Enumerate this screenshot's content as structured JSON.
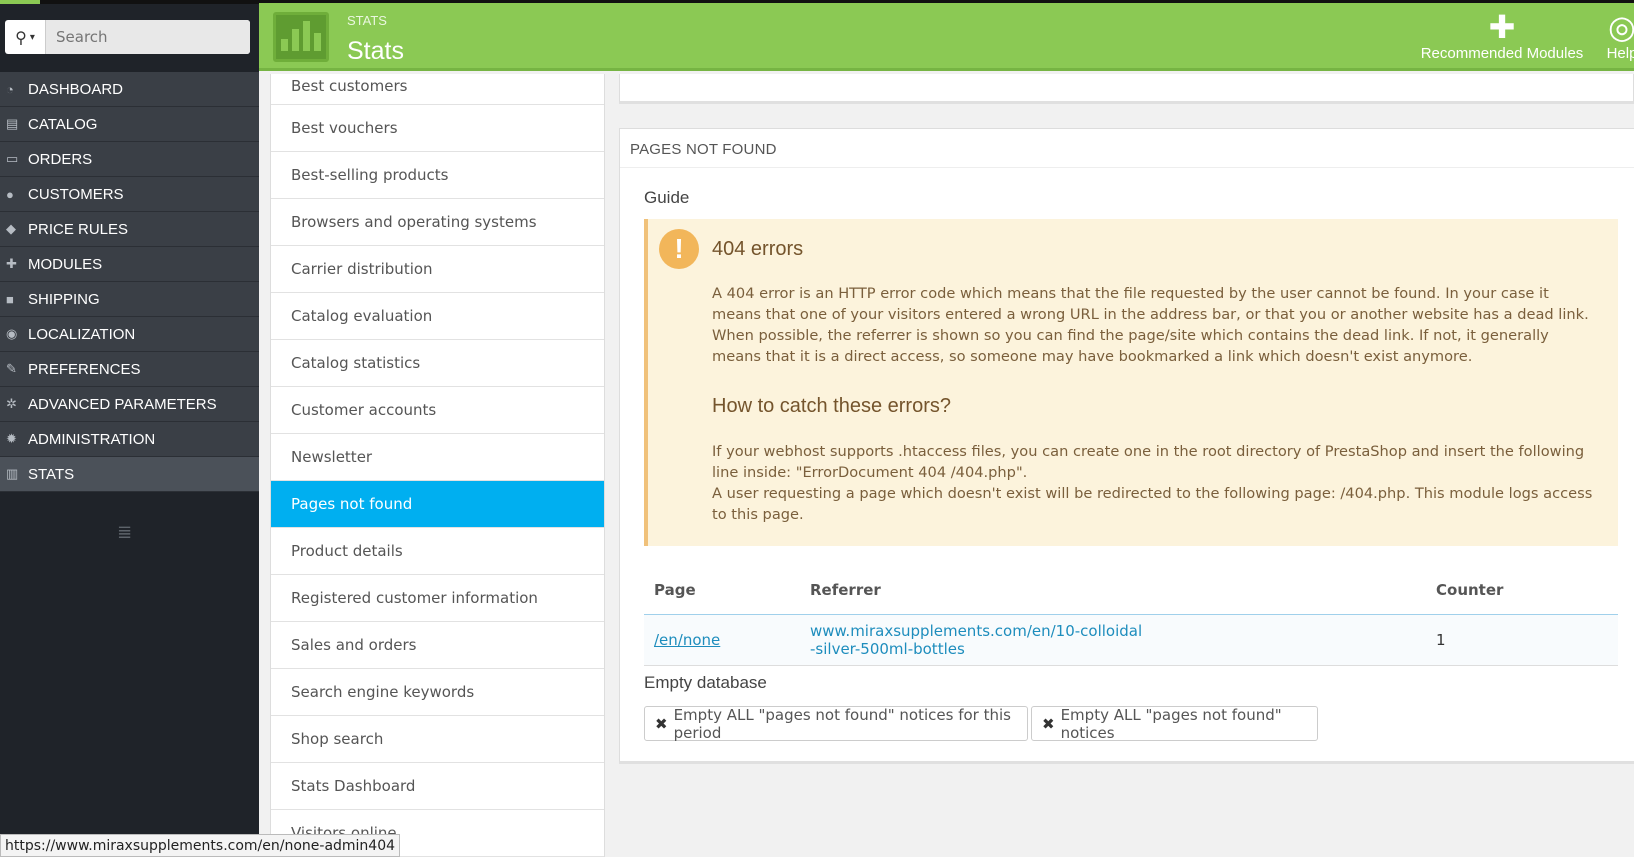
{
  "search": {
    "placeholder": "Search"
  },
  "sidebar": {
    "items": [
      {
        "label": "DASHBOARD",
        "icon": "tachometer-icon",
        "glyph": "◔"
      },
      {
        "label": "CATALOG",
        "icon": "book-icon",
        "glyph": "▤"
      },
      {
        "label": "ORDERS",
        "icon": "credit-card-icon",
        "glyph": "▭"
      },
      {
        "label": "CUSTOMERS",
        "icon": "users-icon",
        "glyph": "●"
      },
      {
        "label": "PRICE RULES",
        "icon": "tags-icon",
        "glyph": "◆"
      },
      {
        "label": "MODULES",
        "icon": "puzzle-icon",
        "glyph": "✚"
      },
      {
        "label": "SHIPPING",
        "icon": "truck-icon",
        "glyph": "■"
      },
      {
        "label": "LOCALIZATION",
        "icon": "globe-icon",
        "glyph": "◉"
      },
      {
        "label": "PREFERENCES",
        "icon": "wrench-icon",
        "glyph": "✎"
      },
      {
        "label": "ADVANCED PARAMETERS",
        "icon": "cogs-icon",
        "glyph": "✲"
      },
      {
        "label": "ADMINISTRATION",
        "icon": "cog-icon",
        "glyph": "✹"
      },
      {
        "label": "STATS",
        "icon": "bar-chart-icon",
        "glyph": "▥",
        "active": true
      }
    ]
  },
  "header": {
    "kicker": "STATS",
    "title": "Stats",
    "recommended_modules": "Recommended Modules",
    "help": "Help"
  },
  "stats_list": [
    "Best customers",
    "Best vouchers",
    "Best-selling products",
    "Browsers and operating systems",
    "Carrier distribution",
    "Catalog evaluation",
    "Catalog statistics",
    "Customer accounts",
    "Newsletter",
    "Pages not found",
    "Product details",
    "Registered customer information",
    "Sales and orders",
    "Search engine keywords",
    "Shop search",
    "Stats Dashboard",
    "Visitors online"
  ],
  "stats_list_active": "Pages not found",
  "panel": {
    "heading": "PAGES NOT FOUND",
    "guide_title": "Guide",
    "alert_title": "404 errors",
    "alert_text": "A 404 error is an HTTP error code which means that the file requested by the user cannot be found. In your case it means that one of your visitors entered a wrong URL in the address bar, or that you or another website has a dead link. When possible, the referrer is shown so you can find the page/site which contains the dead link. If not, it generally means that it is a direct access, so someone may have bookmarked a link which doesn't exist anymore.",
    "alert_subtitle": "How to catch these errors?",
    "alert_text2a": "If your webhost supports .htaccess files, you can create one in the root directory of PrestaShop and insert the following line inside: \"ErrorDocument 404 /404.php\".",
    "alert_text2b": "A user requesting a page which doesn't exist will be redirected to the following page: /404.php. This module logs access to this page.",
    "table": {
      "headers": {
        "page": "Page",
        "referrer": "Referrer",
        "counter": "Counter"
      },
      "rows": [
        {
          "page": "/en/none",
          "referrer_line1": "www.miraxsupplements.com/en/10-colloidal",
          "referrer_line2": "-silver-500ml-bottles",
          "counter": "1"
        }
      ]
    },
    "empty_db_title": "Empty database",
    "btn_empty_period": "Empty ALL \"pages not found\" notices for this period",
    "btn_empty_all": "Empty ALL \"pages not found\" notices"
  },
  "status_url": "https://www.miraxsupplements.com/en/none-admin404",
  "colors": {
    "header_green": "#8bc954",
    "sidebar_dark": "#1f2329",
    "active_blue": "#00aff0",
    "alert_bg": "#fcf3dc"
  }
}
